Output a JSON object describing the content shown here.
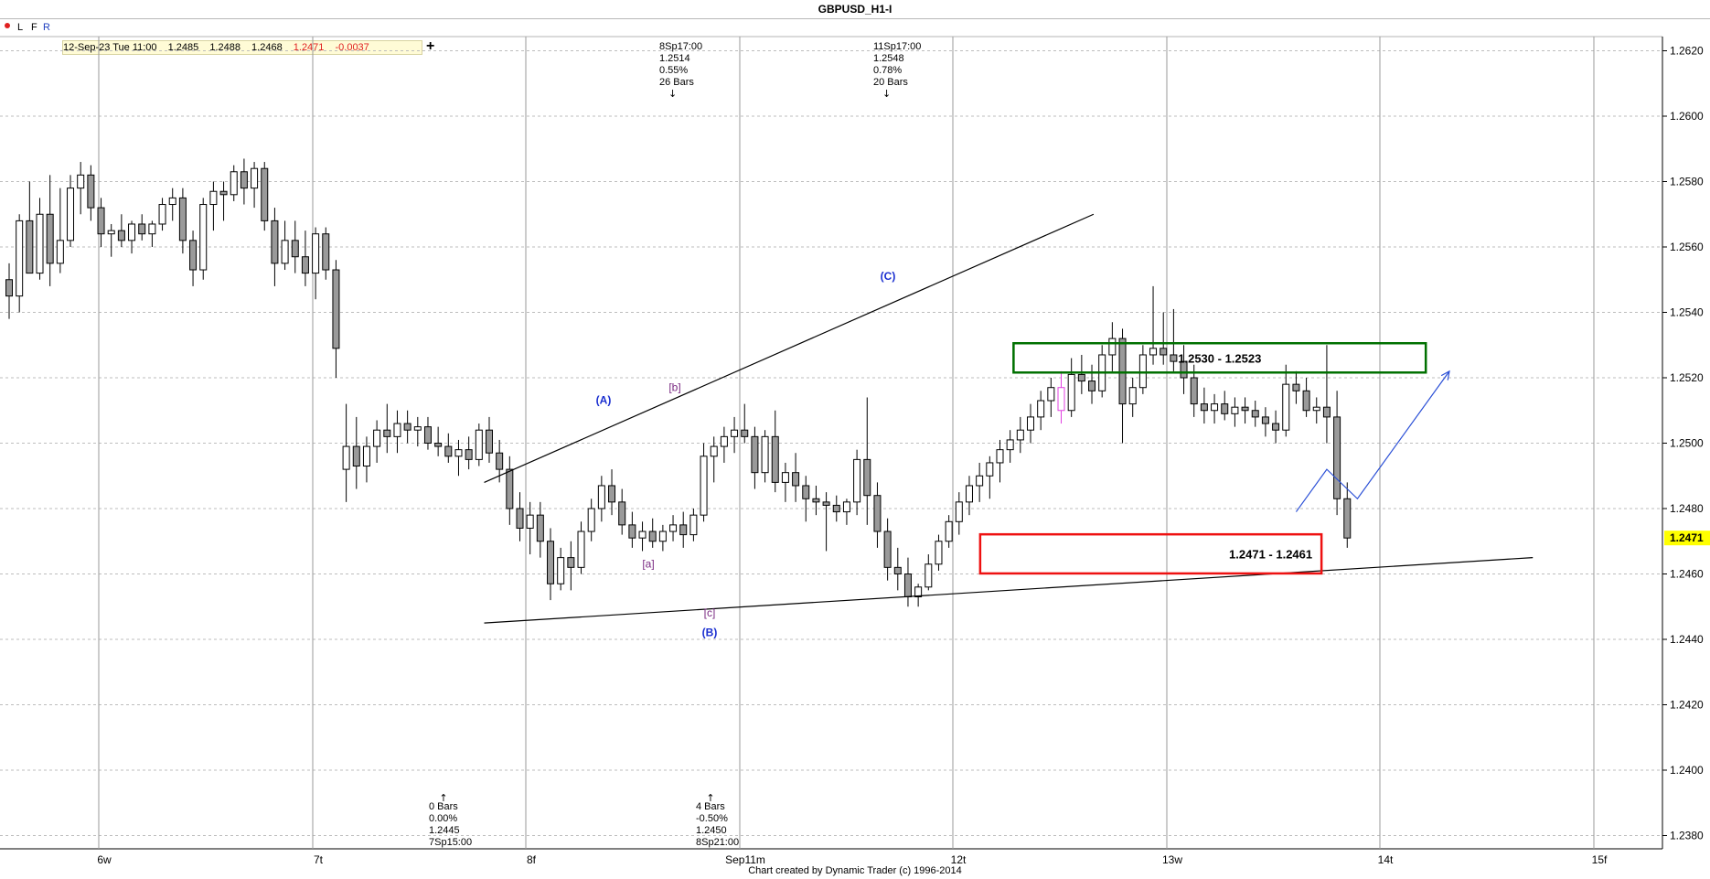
{
  "window": {
    "title": "GBPUSD_H1-I"
  },
  "toolbar": {
    "buttons": [
      {
        "label": "L",
        "color": "#000000"
      },
      {
        "label": "F",
        "color": "#000000"
      },
      {
        "label": "R",
        "color": "#1f3fbf"
      }
    ],
    "dot_color": "#e02020",
    "quote": {
      "date": "12-Sep-23 Tue 11:00",
      "open": "1.2485",
      "high": "1.2488",
      "low": "1.2468",
      "close": "1.2471",
      "change": "-0.0037"
    },
    "add_label": "+"
  },
  "footer": {
    "credit": "Chart created by Dynamic Trader  (c) 1996-2014"
  },
  "chart_data": {
    "type": "candlestick",
    "title": "GBPUSD_H1-I",
    "y_range": [
      1.237,
      1.2635
    ],
    "y_ticks": [
      "1.2380",
      "1.2400",
      "1.2420",
      "1.2440",
      "1.2460",
      "1.2480",
      "1.2500",
      "1.2520",
      "1.2540",
      "1.2560",
      "1.2580",
      "1.2600",
      "1.2620"
    ],
    "x_range": [
      0,
      167
    ],
    "x_ticks": [
      {
        "label": "6w",
        "x": 10
      },
      {
        "label": "7t",
        "x": 31
      },
      {
        "label": "8f",
        "x": 52
      },
      {
        "label": "Sep11m",
        "x": 73
      },
      {
        "label": "12t",
        "x": 94
      },
      {
        "label": "13w",
        "x": 115
      },
      {
        "label": "14t",
        "x": 136
      },
      {
        "label": "15f",
        "x": 157
      }
    ],
    "grid": true,
    "current_price": {
      "label": "1.2471",
      "value": 1.2471,
      "color": "#ffff00"
    },
    "candles": [
      [
        1.255,
        1.2555,
        1.2538,
        1.2545
      ],
      [
        1.2545,
        1.257,
        1.254,
        1.2568
      ],
      [
        1.2568,
        1.258,
        1.256,
        1.2552
      ],
      [
        1.2552,
        1.2575,
        1.255,
        1.257
      ],
      [
        1.257,
        1.2582,
        1.2548,
        1.2555
      ],
      [
        1.2555,
        1.2578,
        1.2552,
        1.2562
      ],
      [
        1.2562,
        1.2582,
        1.256,
        1.2578
      ],
      [
        1.2578,
        1.2586,
        1.257,
        1.2582
      ],
      [
        1.2582,
        1.2585,
        1.2568,
        1.2572
      ],
      [
        1.2572,
        1.2575,
        1.256,
        1.2564
      ],
      [
        1.2564,
        1.2567,
        1.2557,
        1.2565
      ],
      [
        1.2565,
        1.257,
        1.256,
        1.2562
      ],
      [
        1.2562,
        1.2568,
        1.2558,
        1.2567
      ],
      [
        1.2567,
        1.257,
        1.2562,
        1.2564
      ],
      [
        1.2564,
        1.2568,
        1.256,
        1.2567
      ],
      [
        1.2567,
        1.2575,
        1.2565,
        1.2573
      ],
      [
        1.2573,
        1.2578,
        1.2568,
        1.2575
      ],
      [
        1.2575,
        1.2578,
        1.2558,
        1.2562
      ],
      [
        1.2562,
        1.2565,
        1.2548,
        1.2553
      ],
      [
        1.2553,
        1.2575,
        1.255,
        1.2573
      ],
      [
        1.2573,
        1.258,
        1.2565,
        1.2577
      ],
      [
        1.2577,
        1.258,
        1.2568,
        1.2576
      ],
      [
        1.2576,
        1.2585,
        1.2574,
        1.2583
      ],
      [
        1.2583,
        1.2587,
        1.2573,
        1.2578
      ],
      [
        1.2578,
        1.2586,
        1.2572,
        1.2584
      ],
      [
        1.2584,
        1.2586,
        1.2565,
        1.2568
      ],
      [
        1.2568,
        1.2572,
        1.2548,
        1.2555
      ],
      [
        1.2555,
        1.2568,
        1.2553,
        1.2562
      ],
      [
        1.2562,
        1.2568,
        1.2552,
        1.2557
      ],
      [
        1.2557,
        1.2565,
        1.2548,
        1.2552
      ],
      [
        1.2552,
        1.2566,
        1.2544,
        1.2564
      ],
      [
        1.2564,
        1.2566,
        1.255,
        1.2553
      ],
      [
        1.2553,
        1.2556,
        1.252,
        1.2529
      ],
      [
        1.2492,
        1.2512,
        1.2482,
        1.2499
      ],
      [
        1.2499,
        1.2508,
        1.2486,
        1.2493
      ],
      [
        1.2493,
        1.2502,
        1.2488,
        1.2499
      ],
      [
        1.2499,
        1.2507,
        1.2494,
        1.2504
      ],
      [
        1.2504,
        1.2512,
        1.2497,
        1.2502
      ],
      [
        1.2502,
        1.251,
        1.2497,
        1.2506
      ],
      [
        1.2506,
        1.251,
        1.25,
        1.2504
      ],
      [
        1.2504,
        1.2508,
        1.2499,
        1.2505
      ],
      [
        1.2505,
        1.2508,
        1.2498,
        1.25
      ],
      [
        1.25,
        1.2505,
        1.2496,
        1.2499
      ],
      [
        1.2499,
        1.2503,
        1.2494,
        1.2496
      ],
      [
        1.2496,
        1.2501,
        1.249,
        1.2498
      ],
      [
        1.2498,
        1.2502,
        1.2492,
        1.2495
      ],
      [
        1.2495,
        1.2506,
        1.2493,
        1.2504
      ],
      [
        1.2504,
        1.2508,
        1.2494,
        1.2497
      ],
      [
        1.2497,
        1.2501,
        1.2488,
        1.2492
      ],
      [
        1.2492,
        1.2496,
        1.2475,
        1.248
      ],
      [
        1.248,
        1.2485,
        1.247,
        1.2474
      ],
      [
        1.2474,
        1.2482,
        1.2466,
        1.2478
      ],
      [
        1.2478,
        1.2482,
        1.2465,
        1.247
      ],
      [
        1.247,
        1.2474,
        1.2452,
        1.2457
      ],
      [
        1.2457,
        1.2468,
        1.2455,
        1.2465
      ],
      [
        1.2465,
        1.247,
        1.2455,
        1.2462
      ],
      [
        1.2462,
        1.2476,
        1.246,
        1.2473
      ],
      [
        1.2473,
        1.2483,
        1.247,
        1.248
      ],
      [
        1.248,
        1.249,
        1.2476,
        1.2487
      ],
      [
        1.2487,
        1.2492,
        1.2478,
        1.2482
      ],
      [
        1.2482,
        1.2486,
        1.2472,
        1.2475
      ],
      [
        1.2475,
        1.2479,
        1.2468,
        1.2471
      ],
      [
        1.2471,
        1.2476,
        1.2467,
        1.2473
      ],
      [
        1.2473,
        1.2477,
        1.2468,
        1.247
      ],
      [
        1.247,
        1.2475,
        1.2467,
        1.2473
      ],
      [
        1.2473,
        1.2478,
        1.247,
        1.2475
      ],
      [
        1.2475,
        1.2479,
        1.2468,
        1.2472
      ],
      [
        1.2472,
        1.248,
        1.247,
        1.2478
      ],
      [
        1.2478,
        1.25,
        1.2476,
        1.2496
      ],
      [
        1.2496,
        1.2502,
        1.2488,
        1.2499
      ],
      [
        1.2499,
        1.2505,
        1.2494,
        1.2502
      ],
      [
        1.2502,
        1.2508,
        1.2497,
        1.2504
      ],
      [
        1.2504,
        1.2512,
        1.25,
        1.2502
      ],
      [
        1.2502,
        1.2505,
        1.2486,
        1.2491
      ],
      [
        1.2491,
        1.2504,
        1.2488,
        1.2502
      ],
      [
        1.2502,
        1.251,
        1.2485,
        1.2488
      ],
      [
        1.2488,
        1.2494,
        1.2482,
        1.2491
      ],
      [
        1.2491,
        1.2497,
        1.2482,
        1.2487
      ],
      [
        1.2487,
        1.249,
        1.2476,
        1.2483
      ],
      [
        1.2483,
        1.2487,
        1.2478,
        1.2482
      ],
      [
        1.2482,
        1.2485,
        1.2467,
        1.2481
      ],
      [
        1.2481,
        1.2484,
        1.2476,
        1.2479
      ],
      [
        1.2479,
        1.2483,
        1.2475,
        1.2482
      ],
      [
        1.2482,
        1.2498,
        1.2478,
        1.2495
      ],
      [
        1.2495,
        1.2514,
        1.2475,
        1.2484
      ],
      [
        1.2484,
        1.2488,
        1.2468,
        1.2473
      ],
      [
        1.2473,
        1.2477,
        1.2458,
        1.2462
      ],
      [
        1.2462,
        1.2468,
        1.2455,
        1.246
      ],
      [
        1.246,
        1.2465,
        1.245,
        1.2453
      ],
      [
        1.2453,
        1.2457,
        1.245,
        1.2456
      ],
      [
        1.2456,
        1.2466,
        1.2455,
        1.2463
      ],
      [
        1.2463,
        1.2472,
        1.2461,
        1.247
      ],
      [
        1.247,
        1.2478,
        1.2468,
        1.2476
      ],
      [
        1.2476,
        1.2485,
        1.2472,
        1.2482
      ],
      [
        1.2482,
        1.249,
        1.2478,
        1.2487
      ],
      [
        1.2487,
        1.2494,
        1.2482,
        1.249
      ],
      [
        1.249,
        1.2496,
        1.2483,
        1.2494
      ],
      [
        1.2494,
        1.2501,
        1.2488,
        1.2498
      ],
      [
        1.2498,
        1.2504,
        1.2494,
        1.2501
      ],
      [
        1.2501,
        1.2508,
        1.2497,
        1.2504
      ],
      [
        1.2504,
        1.2512,
        1.25,
        1.2508
      ],
      [
        1.2508,
        1.2516,
        1.2504,
        1.2513
      ],
      [
        1.2513,
        1.252,
        1.2508,
        1.2517
      ],
      [
        1.2517,
        1.2522,
        1.2506,
        1.251
      ],
      [
        1.251,
        1.2526,
        1.2508,
        1.2521
      ],
      [
        1.2521,
        1.2527,
        1.2515,
        1.2519
      ],
      [
        1.2519,
        1.2524,
        1.2512,
        1.2516
      ],
      [
        1.2516,
        1.253,
        1.2514,
        1.2527
      ],
      [
        1.2527,
        1.2537,
        1.2522,
        1.2532
      ],
      [
        1.2532,
        1.2535,
        1.25,
        1.2512
      ],
      [
        1.2512,
        1.252,
        1.2508,
        1.2517
      ],
      [
        1.2517,
        1.253,
        1.2515,
        1.2527
      ],
      [
        1.2527,
        1.2548,
        1.2524,
        1.2529
      ],
      [
        1.2529,
        1.254,
        1.2524,
        1.2527
      ],
      [
        1.2527,
        1.2541,
        1.2522,
        1.2525
      ],
      [
        1.2525,
        1.253,
        1.2515,
        1.252
      ],
      [
        1.252,
        1.2524,
        1.2508,
        1.2512
      ],
      [
        1.2512,
        1.2517,
        1.2506,
        1.251
      ],
      [
        1.251,
        1.2515,
        1.2506,
        1.2512
      ],
      [
        1.2512,
        1.2516,
        1.2507,
        1.2509
      ],
      [
        1.2509,
        1.2514,
        1.2505,
        1.2511
      ],
      [
        1.2511,
        1.2514,
        1.2506,
        1.251
      ],
      [
        1.251,
        1.2513,
        1.2505,
        1.2508
      ],
      [
        1.2508,
        1.2511,
        1.2502,
        1.2506
      ],
      [
        1.2506,
        1.251,
        1.25,
        1.2504
      ],
      [
        1.2504,
        1.2524,
        1.2502,
        1.2518
      ],
      [
        1.2518,
        1.2522,
        1.2512,
        1.2516
      ],
      [
        1.2516,
        1.252,
        1.2508,
        1.251
      ],
      [
        1.251,
        1.2514,
        1.2506,
        1.2511
      ],
      [
        1.2511,
        1.253,
        1.25,
        1.2508
      ],
      [
        1.2508,
        1.2516,
        1.2478,
        1.2483
      ],
      [
        1.2483,
        1.2488,
        1.2468,
        1.2471
      ]
    ],
    "highlight_candle": {
      "index": 103,
      "color": "#e040e0"
    },
    "lines": [
      {
        "name": "upper trendline",
        "from": [
          56,
          1.2488
        ],
        "to": [
          123,
          1.257
        ],
        "color": "#000000"
      },
      {
        "name": "lower trendline",
        "from": [
          56,
          1.2445
        ],
        "to": [
          166,
          1.2465
        ],
        "color": "#000000"
      },
      {
        "name": "projected path",
        "points": [
          [
            126,
            1.2479
          ],
          [
            129,
            1.2492
          ],
          [
            132,
            1.2483
          ],
          [
            141,
            1.2522
          ]
        ],
        "color": "#2a4fd6"
      }
    ],
    "zones": [
      {
        "label": "1.2530 - 1.2523",
        "top": 1.253,
        "bottom": 1.2523,
        "x_start": 114,
        "x_end": 160,
        "color": "#007000"
      },
      {
        "label": "1.2471 - 1.2461",
        "top": 1.2471,
        "bottom": 1.2461,
        "x_start": 111,
        "x_end": 142,
        "color": "#ee1111"
      }
    ],
    "wave_labels": [
      {
        "text": "(A)",
        "x": 71,
        "y": 1.2512,
        "color": "#1a2fd0"
      },
      {
        "text": "[b]",
        "x": 79,
        "y": 1.2516,
        "color": "#7a2a82"
      },
      {
        "text": "[a]",
        "x": 76,
        "y": 1.2462,
        "color": "#7a2a82"
      },
      {
        "text": "[c]",
        "x": 84,
        "y": 1.2447,
        "color": "#7a2a82"
      },
      {
        "text": "(B)",
        "x": 84,
        "y": 1.2441,
        "color": "#1a2fd0"
      },
      {
        "text": "(C)",
        "x": 105,
        "y": 1.255,
        "color": "#1a2fd0"
      }
    ],
    "annotations": [
      {
        "lines": [
          "8Sp17:00",
          "1.2514",
          "0.55%",
          "26 Bars"
        ],
        "arrow": "↓",
        "x": 79,
        "pos": "top"
      },
      {
        "lines": [
          "11Sp17:00",
          "1.2548",
          "0.78%",
          "20 Bars"
        ],
        "arrow": "↓",
        "x": 104,
        "pos": "top"
      },
      {
        "lines": [
          "0 Bars",
          "0.00%",
          "1.2445",
          "7Sp15:00"
        ],
        "arrow": "↑",
        "x": 50,
        "pos": "bottom"
      },
      {
        "lines": [
          "4 Bars",
          "-0.50%",
          "1.2450",
          "8Sp21:00"
        ],
        "arrow": "↑",
        "x": 81,
        "pos": "bottom"
      }
    ]
  }
}
